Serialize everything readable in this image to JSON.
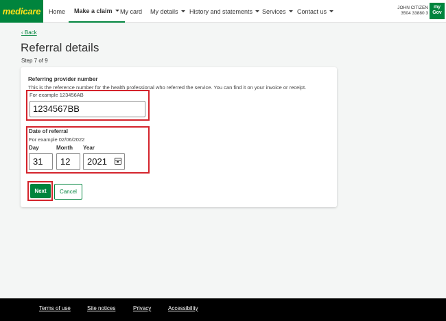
{
  "header": {
    "logo_text": "medicare",
    "nav": [
      {
        "label": "Home"
      },
      {
        "label": "Make a claim"
      },
      {
        "label": "My card"
      },
      {
        "label": "My details"
      },
      {
        "label": "History and statements"
      },
      {
        "label": "Services"
      },
      {
        "label": "Contact us"
      }
    ],
    "user_name": "JOHN CITIZEN",
    "user_card": "3504 33880 3",
    "mygov_line1": "my",
    "mygov_line2": "Gov"
  },
  "page": {
    "back_label": "‹ Back",
    "title": "Referral details",
    "step": "Step 7 of 9"
  },
  "form": {
    "provider": {
      "label": "Referring provider number",
      "description": "This is the reference number for the health professional who referred the service. You can find it on your invoice or receipt.",
      "hint": "For example 123456AB",
      "value": "1234567BB"
    },
    "date": {
      "label": "Date of referral",
      "hint": "For example 02/06/2022",
      "day_label": "Day",
      "month_label": "Month",
      "year_label": "Year",
      "day_value": "31",
      "month_value": "12",
      "year_value": "2021"
    },
    "next_label": "Next",
    "cancel_label": "Cancel"
  },
  "footer": {
    "links": [
      {
        "label": "Terms of use"
      },
      {
        "label": "Site notices"
      },
      {
        "label": "Privacy"
      },
      {
        "label": "Accessibility"
      }
    ]
  },
  "colors": {
    "brand_green": "#00843d",
    "logo_yellow": "#ffe11a",
    "highlight_red": "#d4232b"
  }
}
